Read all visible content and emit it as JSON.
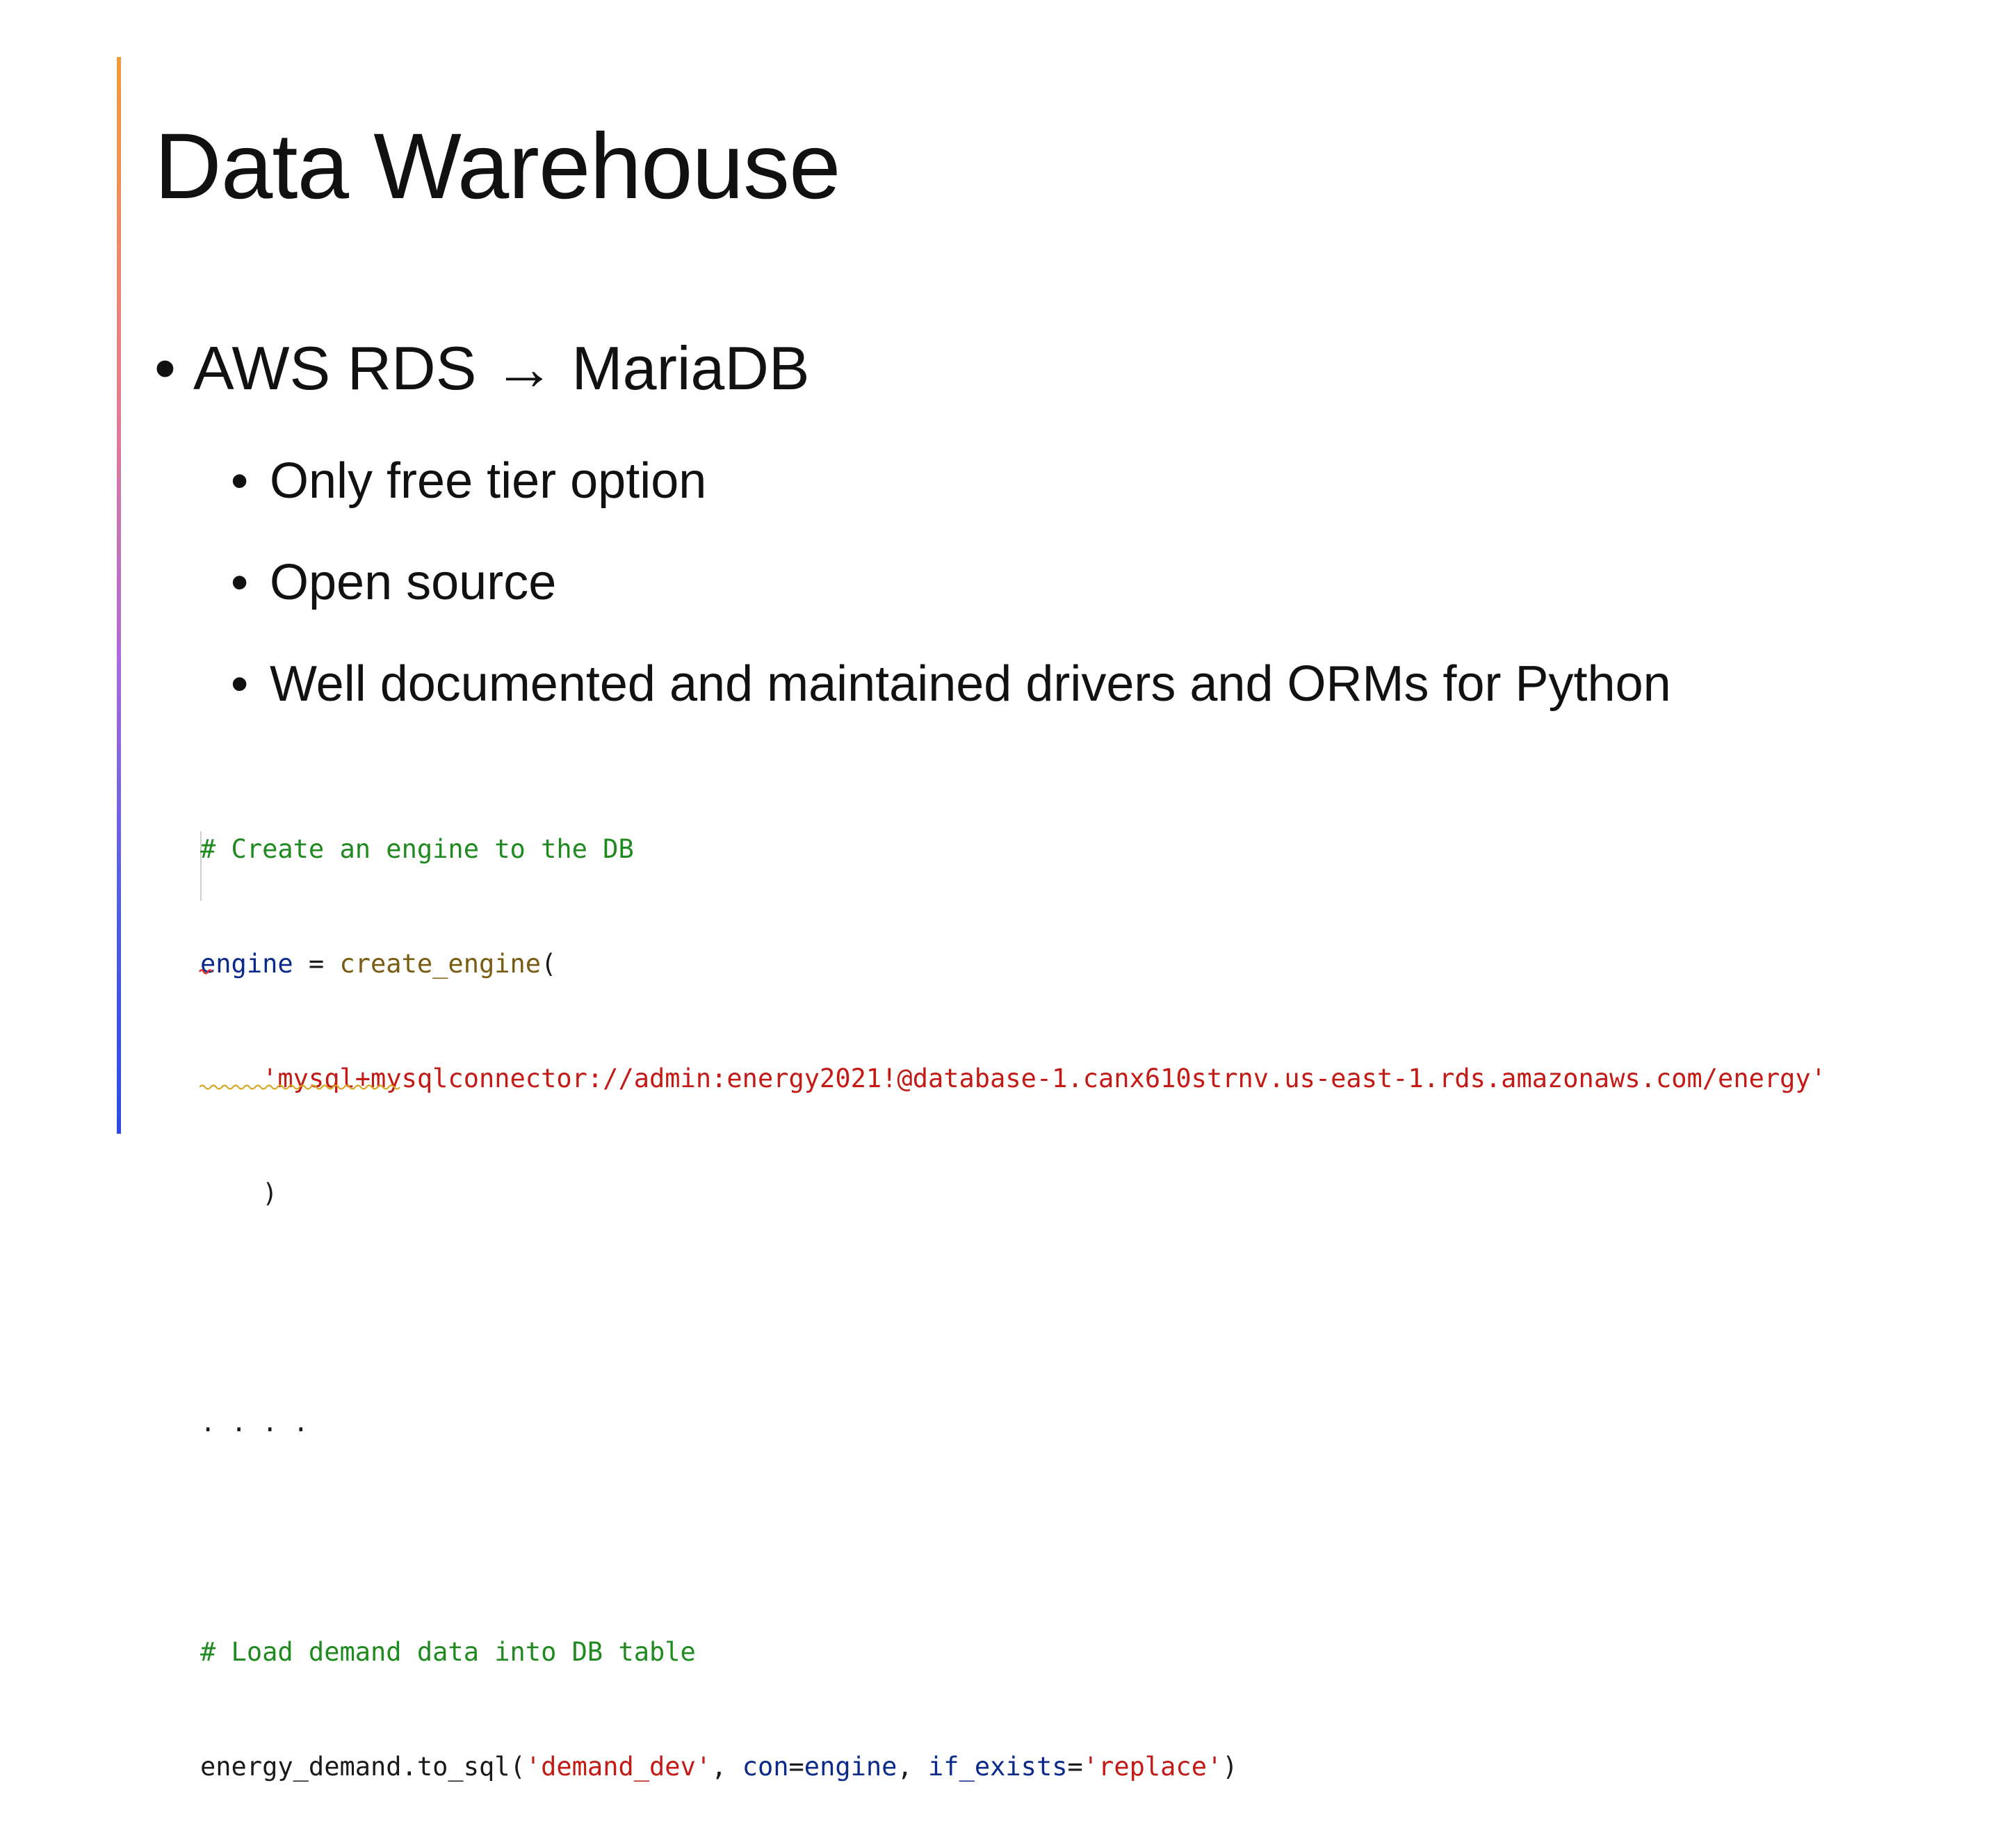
{
  "slide": {
    "title": "Data Warehouse",
    "bullet_main": {
      "marker": "•",
      "text": "AWS RDS → MariaDB"
    },
    "sub_bullets": [
      {
        "marker": "•",
        "text": "Only free tier option"
      },
      {
        "marker": "•",
        "text": "Open source"
      },
      {
        "marker": "•",
        "text": "Well documented and maintained drivers and ORMs for Python"
      }
    ]
  },
  "code": {
    "comment1": "# Create an engine to the DB",
    "line2_var": "engine",
    "line2_op": " = ",
    "line2_func": "create_engine",
    "line2_paren": "(",
    "line3_indent": "    ",
    "line3_str": "'mysql+mysqlconnector://admin:energy2021!@database-1.canx610strnv.us-east-1.rds.amazonaws.com/energy'",
    "line4": "    )",
    "ellipsis": ". . . .",
    "comment2": "# Load demand data into DB table",
    "line7_obj": "energy_demand",
    "line7_method": ".to_sql(",
    "line7_str1": "'demand_dev'",
    "line7_sep1": ", ",
    "line7_kw1": "con",
    "line7_eq1": "=",
    "line7_val1": "engine",
    "line7_sep2": ", ",
    "line7_kw2": "if_exists",
    "line7_eq2": "=",
    "line7_str2": "'replace'",
    "line7_close": ")"
  },
  "colors": {
    "accent_top": "#f29a3a",
    "accent_bottom": "#2f49e6",
    "comment": "#1f8a1f",
    "string": "#c41a16",
    "identifier": "#0b2a8a",
    "function": "#7a5b12"
  }
}
